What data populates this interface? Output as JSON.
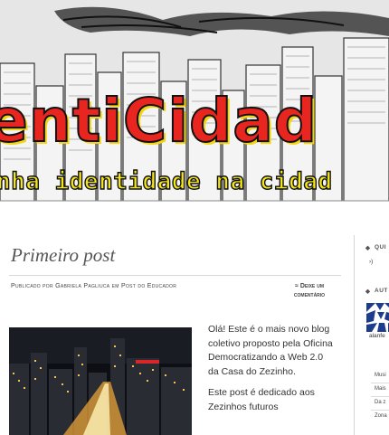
{
  "header": {
    "banner_title": "entiCidad",
    "banner_subtitle": "nha identidade na cidad"
  },
  "post": {
    "title": "Primeiro post",
    "meta_published": "Publicado por",
    "meta_author": "Gabriela Pagliuca",
    "meta_in": "em",
    "meta_category": "Post do Educador",
    "comment_icon": "≈",
    "comment_label_line1": "Deixe um",
    "comment_label_line2": "comentário",
    "paragraph1": "Olá! Este é o mais novo blog coletivo proposto pela Oficina Democratizando a Web 2.0 da Casa do Zezinho.",
    "paragraph2": "Este post é dedicado aos Zezinhos futuros"
  },
  "sidebar": {
    "section1_title": "QUI",
    "section1_item": "›)",
    "section2_title": "AUT",
    "author_name": "alanfe",
    "links": [
      "Musi",
      "Mais",
      "Da z",
      "Zona"
    ]
  },
  "icons": {
    "bullet": "diamond-icon",
    "comment": "comment-icon"
  },
  "colors": {
    "accent": "#e8261f",
    "subtitle": "#f4e41a",
    "avatar": "#1d3c8c"
  }
}
